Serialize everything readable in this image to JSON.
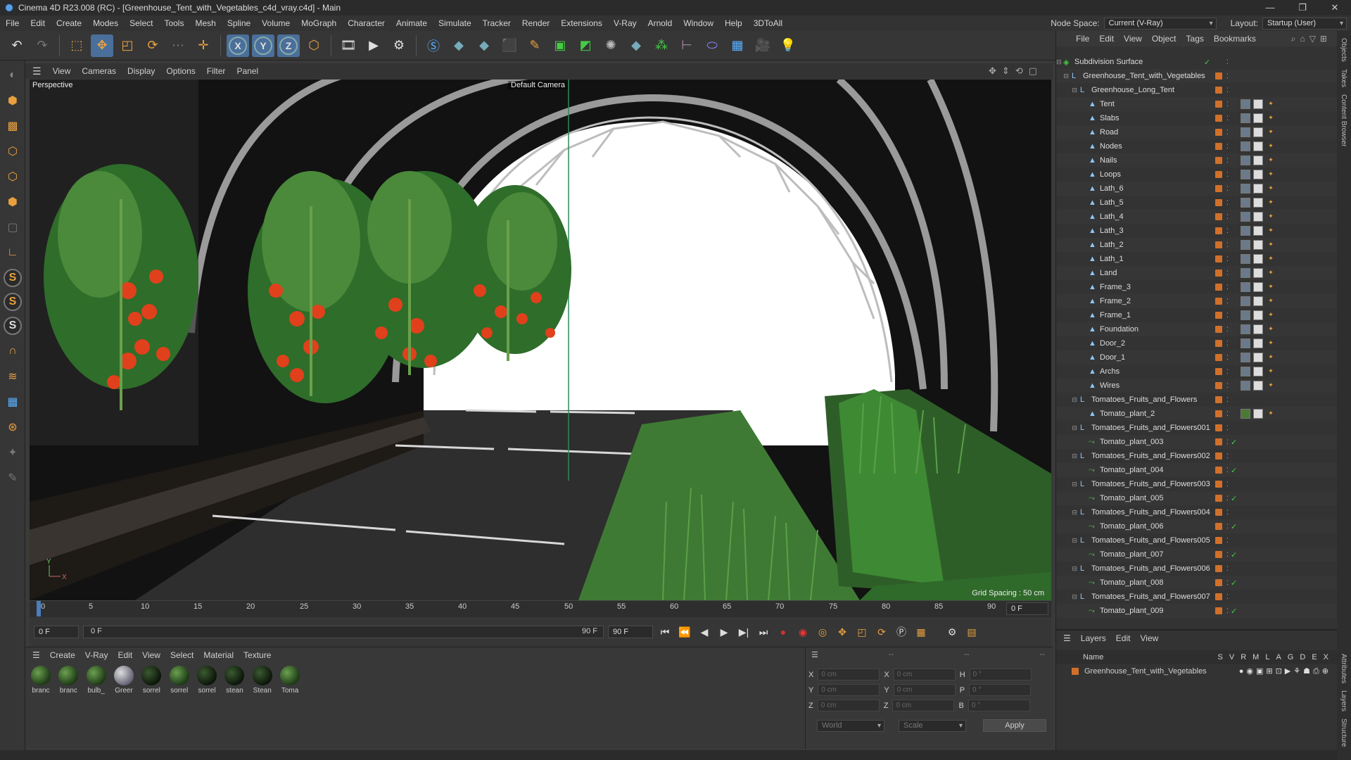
{
  "window": {
    "title": "Cinema 4D R23.008 (RC) - [Greenhouse_Tent_with_Vegetables_c4d_vray.c4d] - Main",
    "controls": [
      "—",
      "❐",
      "✕"
    ]
  },
  "menubar": {
    "items": [
      "File",
      "Edit",
      "Create",
      "Modes",
      "Select",
      "Tools",
      "Mesh",
      "Spline",
      "Volume",
      "MoGraph",
      "Character",
      "Animate",
      "Simulate",
      "Tracker",
      "Render",
      "Extensions",
      "V-Ray",
      "Arnold",
      "Window",
      "Help",
      "3DToAll"
    ],
    "node_space_label": "Node Space:",
    "node_space_value": "Current (V-Ray)",
    "layout_label": "Layout:",
    "layout_value": "Startup (User)"
  },
  "viewport": {
    "menu": [
      "View",
      "Cameras",
      "Display",
      "Options",
      "Filter",
      "Panel"
    ],
    "label": "Perspective",
    "camera": "Default Camera",
    "grid_spacing": "Grid Spacing : 50 cm"
  },
  "timeline": {
    "ticks": [
      "0",
      "5",
      "10",
      "15",
      "20",
      "25",
      "30",
      "35",
      "40",
      "45",
      "50",
      "55",
      "60",
      "65",
      "70",
      "75",
      "80",
      "85",
      "90"
    ],
    "current_frame_label": "0 F",
    "start_field": "0 F",
    "range_start": "0 F",
    "range_end": "90 F",
    "end_field": "90 F"
  },
  "materials": {
    "menu": [
      "Create",
      "V-Ray",
      "Edit",
      "View",
      "Select",
      "Material",
      "Texture"
    ],
    "items": [
      "branc",
      "branc",
      "bulb_",
      "Greer",
      "sorrel",
      "sorrel",
      "sorrel",
      "stean",
      "Stean",
      "Toma"
    ]
  },
  "coordinates": {
    "rows": [
      {
        "a": "X",
        "av": "0 cm",
        "b": "X",
        "bv": "0 cm",
        "c": "H",
        "cv": "0 °"
      },
      {
        "a": "Y",
        "av": "0 cm",
        "b": "Y",
        "bv": "0 cm",
        "c": "P",
        "cv": "0 °"
      },
      {
        "a": "Z",
        "av": "0 cm",
        "b": "Z",
        "bv": "0 cm",
        "c": "B",
        "cv": "0 °"
      }
    ],
    "mode": "World",
    "scale": "Scale",
    "apply": "Apply",
    "header_a": "--",
    "header_b": "--",
    "header_c": "--"
  },
  "objects": {
    "menu": [
      "File",
      "Edit",
      "View",
      "Object",
      "Tags",
      "Bookmarks"
    ],
    "rows": [
      {
        "name": "Subdivision Surface",
        "indent": 0,
        "kind": "sub"
      },
      {
        "name": "Greenhouse_Tent_with_Vegetables",
        "indent": 1,
        "kind": "null"
      },
      {
        "name": "Greenhouse_Long_Tent",
        "indent": 2,
        "kind": "null"
      },
      {
        "name": "Tent",
        "indent": 3,
        "kind": "mesh"
      },
      {
        "name": "Slabs",
        "indent": 3,
        "kind": "mesh"
      },
      {
        "name": "Road",
        "indent": 3,
        "kind": "mesh"
      },
      {
        "name": "Nodes",
        "indent": 3,
        "kind": "mesh"
      },
      {
        "name": "Nails",
        "indent": 3,
        "kind": "mesh"
      },
      {
        "name": "Loops",
        "indent": 3,
        "kind": "mesh"
      },
      {
        "name": "Lath_6",
        "indent": 3,
        "kind": "mesh"
      },
      {
        "name": "Lath_5",
        "indent": 3,
        "kind": "mesh"
      },
      {
        "name": "Lath_4",
        "indent": 3,
        "kind": "mesh"
      },
      {
        "name": "Lath_3",
        "indent": 3,
        "kind": "mesh"
      },
      {
        "name": "Lath_2",
        "indent": 3,
        "kind": "mesh"
      },
      {
        "name": "Lath_1",
        "indent": 3,
        "kind": "mesh"
      },
      {
        "name": "Land",
        "indent": 3,
        "kind": "mesh"
      },
      {
        "name": "Frame_3",
        "indent": 3,
        "kind": "mesh"
      },
      {
        "name": "Frame_2",
        "indent": 3,
        "kind": "mesh"
      },
      {
        "name": "Frame_1",
        "indent": 3,
        "kind": "mesh"
      },
      {
        "name": "Foundation",
        "indent": 3,
        "kind": "mesh"
      },
      {
        "name": "Door_2",
        "indent": 3,
        "kind": "mesh"
      },
      {
        "name": "Door_1",
        "indent": 3,
        "kind": "mesh"
      },
      {
        "name": "Archs",
        "indent": 3,
        "kind": "mesh"
      },
      {
        "name": "Wires",
        "indent": 3,
        "kind": "mesh"
      },
      {
        "name": "Tomatoes_Fruits_and_Flowers",
        "indent": 2,
        "kind": "null"
      },
      {
        "name": "Tomato_plant_2",
        "indent": 3,
        "kind": "mesh2"
      },
      {
        "name": "Tomatoes_Fruits_and_Flowers001",
        "indent": 2,
        "kind": "null"
      },
      {
        "name": "Tomato_plant_003",
        "indent": 3,
        "kind": "inst"
      },
      {
        "name": "Tomatoes_Fruits_and_Flowers002",
        "indent": 2,
        "kind": "null"
      },
      {
        "name": "Tomato_plant_004",
        "indent": 3,
        "kind": "inst"
      },
      {
        "name": "Tomatoes_Fruits_and_Flowers003",
        "indent": 2,
        "kind": "null"
      },
      {
        "name": "Tomato_plant_005",
        "indent": 3,
        "kind": "inst"
      },
      {
        "name": "Tomatoes_Fruits_and_Flowers004",
        "indent": 2,
        "kind": "null"
      },
      {
        "name": "Tomato_plant_006",
        "indent": 3,
        "kind": "inst"
      },
      {
        "name": "Tomatoes_Fruits_and_Flowers005",
        "indent": 2,
        "kind": "null"
      },
      {
        "name": "Tomato_plant_007",
        "indent": 3,
        "kind": "inst"
      },
      {
        "name": "Tomatoes_Fruits_and_Flowers006",
        "indent": 2,
        "kind": "null"
      },
      {
        "name": "Tomato_plant_008",
        "indent": 3,
        "kind": "inst"
      },
      {
        "name": "Tomatoes_Fruits_and_Flowers007",
        "indent": 2,
        "kind": "null"
      },
      {
        "name": "Tomato_plant_009",
        "indent": 3,
        "kind": "inst"
      }
    ]
  },
  "layers": {
    "menu": [
      "Layers",
      "Edit",
      "View"
    ],
    "col_name": "Name",
    "cols": [
      "S",
      "V",
      "R",
      "M",
      "L",
      "A",
      "G",
      "D",
      "E",
      "X"
    ],
    "row": "Greenhouse_Tent_with_Vegetables"
  },
  "side_tabs": [
    "Objects",
    "Takes",
    "Content Browser",
    "Attributes",
    "Layers",
    "Structure"
  ],
  "colors": {
    "accent": "#4a6f9a",
    "layer": "#d0702a",
    "sky": "#ffffff",
    "grass": "#3f7a34"
  }
}
